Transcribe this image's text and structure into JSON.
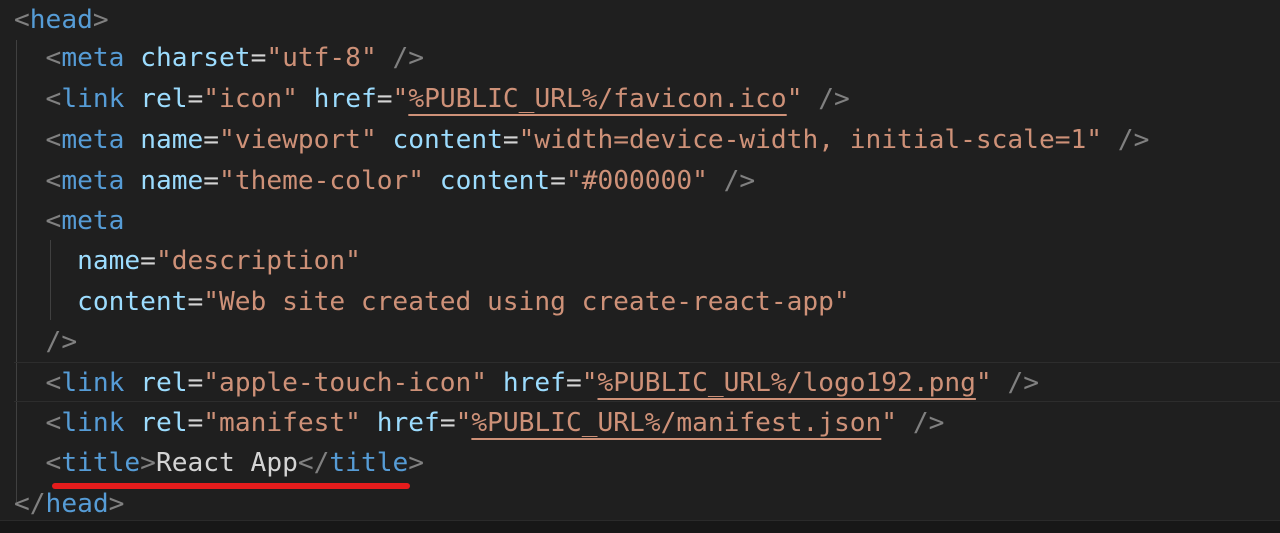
{
  "editor": {
    "lines": [
      {
        "tokens": [
          {
            "t": "<",
            "c": "punct"
          },
          {
            "t": "head",
            "c": "tag"
          },
          {
            "t": ">",
            "c": "punct"
          }
        ]
      },
      {
        "tokens": [
          {
            "t": "  ",
            "c": "text"
          },
          {
            "t": "<",
            "c": "punct"
          },
          {
            "t": "meta",
            "c": "tag"
          },
          {
            "t": " ",
            "c": "text"
          },
          {
            "t": "charset",
            "c": "attr"
          },
          {
            "t": "=",
            "c": "eq"
          },
          {
            "t": "\"utf-8\"",
            "c": "str"
          },
          {
            "t": " ",
            "c": "text"
          },
          {
            "t": "/>",
            "c": "punct"
          }
        ]
      },
      {
        "tokens": [
          {
            "t": "  ",
            "c": "text"
          },
          {
            "t": "<",
            "c": "punct"
          },
          {
            "t": "link",
            "c": "tag"
          },
          {
            "t": " ",
            "c": "text"
          },
          {
            "t": "rel",
            "c": "attr"
          },
          {
            "t": "=",
            "c": "eq"
          },
          {
            "t": "\"icon\"",
            "c": "str"
          },
          {
            "t": " ",
            "c": "text"
          },
          {
            "t": "href",
            "c": "attr"
          },
          {
            "t": "=",
            "c": "eq"
          },
          {
            "t": "\"",
            "c": "str"
          },
          {
            "t": "%PUBLIC_URL%/favicon.ico",
            "c": "str ul"
          },
          {
            "t": "\"",
            "c": "str"
          },
          {
            "t": " ",
            "c": "text"
          },
          {
            "t": "/>",
            "c": "punct"
          }
        ]
      },
      {
        "tokens": [
          {
            "t": "  ",
            "c": "text"
          },
          {
            "t": "<",
            "c": "punct"
          },
          {
            "t": "meta",
            "c": "tag"
          },
          {
            "t": " ",
            "c": "text"
          },
          {
            "t": "name",
            "c": "attr"
          },
          {
            "t": "=",
            "c": "eq"
          },
          {
            "t": "\"viewport\"",
            "c": "str"
          },
          {
            "t": " ",
            "c": "text"
          },
          {
            "t": "content",
            "c": "attr"
          },
          {
            "t": "=",
            "c": "eq"
          },
          {
            "t": "\"width=device-width, initial-scale=1\"",
            "c": "str"
          },
          {
            "t": " ",
            "c": "text"
          },
          {
            "t": "/>",
            "c": "punct"
          }
        ]
      },
      {
        "tokens": [
          {
            "t": "  ",
            "c": "text"
          },
          {
            "t": "<",
            "c": "punct"
          },
          {
            "t": "meta",
            "c": "tag"
          },
          {
            "t": " ",
            "c": "text"
          },
          {
            "t": "name",
            "c": "attr"
          },
          {
            "t": "=",
            "c": "eq"
          },
          {
            "t": "\"theme-color\"",
            "c": "str"
          },
          {
            "t": " ",
            "c": "text"
          },
          {
            "t": "content",
            "c": "attr"
          },
          {
            "t": "=",
            "c": "eq"
          },
          {
            "t": "\"#000000\"",
            "c": "str"
          },
          {
            "t": " ",
            "c": "text"
          },
          {
            "t": "/>",
            "c": "punct"
          }
        ]
      },
      {
        "tokens": [
          {
            "t": "  ",
            "c": "text"
          },
          {
            "t": "<",
            "c": "punct"
          },
          {
            "t": "meta",
            "c": "tag"
          }
        ]
      },
      {
        "tokens": [
          {
            "t": "    ",
            "c": "text"
          },
          {
            "t": "name",
            "c": "attr"
          },
          {
            "t": "=",
            "c": "eq"
          },
          {
            "t": "\"description\"",
            "c": "str"
          }
        ]
      },
      {
        "tokens": [
          {
            "t": "    ",
            "c": "text"
          },
          {
            "t": "content",
            "c": "attr"
          },
          {
            "t": "=",
            "c": "eq"
          },
          {
            "t": "\"Web site created using create-react-app\"",
            "c": "str"
          }
        ]
      },
      {
        "tokens": [
          {
            "t": "  ",
            "c": "text"
          },
          {
            "t": "/>",
            "c": "punct"
          }
        ]
      },
      {
        "tokens": [
          {
            "t": "  ",
            "c": "text"
          },
          {
            "t": "<",
            "c": "punct"
          },
          {
            "t": "link",
            "c": "tag"
          },
          {
            "t": " ",
            "c": "text"
          },
          {
            "t": "rel",
            "c": "attr"
          },
          {
            "t": "=",
            "c": "eq"
          },
          {
            "t": "\"apple-touch-icon\"",
            "c": "str"
          },
          {
            "t": " ",
            "c": "text"
          },
          {
            "t": "href",
            "c": "attr"
          },
          {
            "t": "=",
            "c": "eq"
          },
          {
            "t": "\"",
            "c": "str"
          },
          {
            "t": "%PUBLIC_URL%/logo192.png",
            "c": "str ul"
          },
          {
            "t": "\"",
            "c": "str"
          },
          {
            "t": " ",
            "c": "text"
          },
          {
            "t": "/>",
            "c": "punct"
          }
        ]
      },
      {
        "tokens": [
          {
            "t": "  ",
            "c": "text"
          },
          {
            "t": "<",
            "c": "punct"
          },
          {
            "t": "link",
            "c": "tag"
          },
          {
            "t": " ",
            "c": "text"
          },
          {
            "t": "rel",
            "c": "attr"
          },
          {
            "t": "=",
            "c": "eq"
          },
          {
            "t": "\"manifest\"",
            "c": "str"
          },
          {
            "t": " ",
            "c": "text"
          },
          {
            "t": "href",
            "c": "attr"
          },
          {
            "t": "=",
            "c": "eq"
          },
          {
            "t": "\"",
            "c": "str"
          },
          {
            "t": "%PUBLIC_URL%/manifest.json",
            "c": "str ul"
          },
          {
            "t": "\"",
            "c": "str"
          },
          {
            "t": " ",
            "c": "text"
          },
          {
            "t": "/>",
            "c": "punct"
          }
        ]
      },
      {
        "tokens": [
          {
            "t": "  ",
            "c": "text"
          },
          {
            "t": "<",
            "c": "punct"
          },
          {
            "t": "title",
            "c": "tag"
          },
          {
            "t": ">",
            "c": "punct"
          },
          {
            "t": "React App",
            "c": "text"
          },
          {
            "t": "</",
            "c": "punct"
          },
          {
            "t": "title",
            "c": "tag"
          },
          {
            "t": ">",
            "c": "punct"
          }
        ]
      },
      {
        "tokens": [
          {
            "t": "</",
            "c": "punct"
          },
          {
            "t": "head",
            "c": "tag"
          },
          {
            "t": ">",
            "c": "punct"
          }
        ]
      }
    ]
  },
  "colors": {
    "background": "#1f1f1f",
    "tag": "#569cd6",
    "attribute": "#9cdcfe",
    "string": "#ce9178",
    "punctuation": "#808080",
    "annotation": "#e51c1c"
  }
}
